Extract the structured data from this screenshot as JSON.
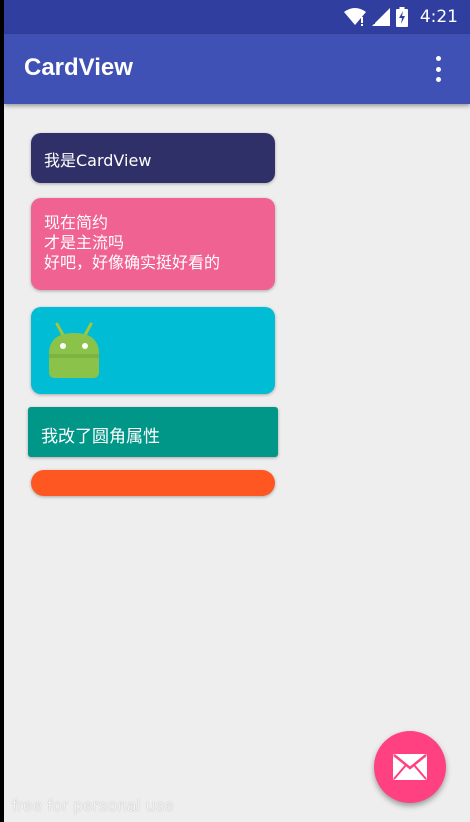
{
  "status_bar": {
    "time": "4:21",
    "icons": [
      "wifi-icon",
      "cellular-signal-icon",
      "battery-charging-icon"
    ]
  },
  "app_bar": {
    "title": "CardView",
    "menu_icon": "overflow-menu-icon"
  },
  "cards": {
    "card1": {
      "text": "我是CardView",
      "color": "#303068"
    },
    "card2": {
      "lines": [
        "现在简约",
        "才是主流吗",
        "好吧，好像确实挺好看的"
      ],
      "color": "#f06292"
    },
    "card3": {
      "icon": "android-robot-icon",
      "color": "#00bcd4"
    },
    "card4": {
      "text": "我改了圆角属性",
      "color": "#009688"
    },
    "card5": {
      "color": "#ff5722"
    }
  },
  "fab": {
    "icon": "mail-icon",
    "color": "#ff4081"
  },
  "watermark": "free for personal use",
  "colors": {
    "primary_dark": "#303f9f",
    "primary": "#3f51b5",
    "background": "#eeeeee"
  }
}
